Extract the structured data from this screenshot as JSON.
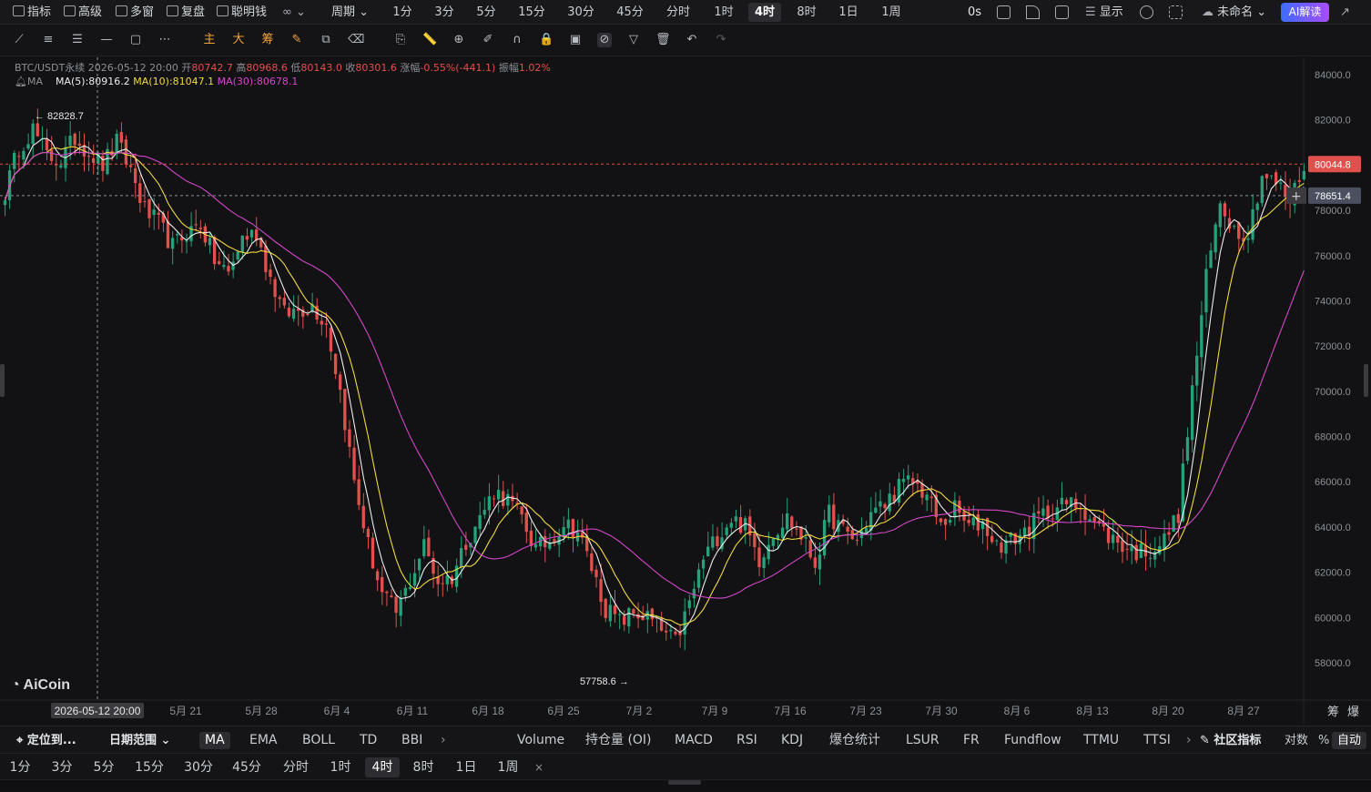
{
  "topbar": {
    "left_items": [
      {
        "label": "指标",
        "icon": "indicator-icon"
      },
      {
        "label": "高级",
        "icon": "advanced-icon"
      },
      {
        "label": "多窗",
        "icon": "multi-window-icon"
      },
      {
        "label": "复盘",
        "icon": "replay-icon"
      },
      {
        "label": "聪明钱",
        "icon": "smart-money-icon"
      }
    ],
    "period_menu": "周期",
    "periods": [
      "1分",
      "3分",
      "5分",
      "15分",
      "30分",
      "45分",
      "分时",
      "1时",
      "4时",
      "8时",
      "1日",
      "1周"
    ],
    "active_period": "4时",
    "countdown": "0s",
    "display_label": "显示",
    "layout_name": "未命名",
    "ai_button": "AI解读"
  },
  "chart_info": {
    "symbol": "BTC/USDT永续",
    "datetime": "2026-05-12 20:00",
    "open_label": "开",
    "open": "80742.7",
    "high_label": "高",
    "high": "80968.6",
    "low_label": "低",
    "low": "80143.0",
    "close_label": "收",
    "close": "80301.6",
    "change_label": "涨幅",
    "change": "-0.55%(-441.1)",
    "amplitude_label": "振幅",
    "amplitude": "1.02%",
    "ma_label": "MA",
    "ma5": "MA(5):80916.2",
    "ma10": "MA(10):81047.1",
    "ma30": "MA(30):80678.1"
  },
  "chart_data": {
    "type": "line",
    "title": "",
    "xlabel": "",
    "ylabel": "",
    "ylim": [
      56500,
      84500
    ],
    "x_ticks": [
      "2026-05-12 20:00",
      "5月 21",
      "5月 28",
      "6月 4",
      "6月 11",
      "6月 18",
      "6月 25",
      "7月 2",
      "7月 9",
      "7月 16",
      "7月 23",
      "7月 30",
      "8月 6",
      "8月 13",
      "8月 20",
      "8月 27"
    ],
    "y_ticks": [
      "84000.0",
      "82000.0",
      "80000.0",
      "78000.0",
      "76000.0",
      "74000.0",
      "72000.0",
      "70000.0",
      "68000.0",
      "66000.0",
      "64000.0",
      "62000.0",
      "60000.0",
      "58000.0"
    ],
    "y_tick_values": [
      84000,
      82000,
      80000,
      78000,
      76000,
      74000,
      72000,
      70000,
      68000,
      66000,
      64000,
      62000,
      60000,
      58000
    ],
    "price_series": [
      [
        0,
        78800
      ],
      [
        3,
        80800
      ],
      [
        6,
        81600
      ],
      [
        9,
        80400
      ],
      [
        12,
        80200
      ],
      [
        15,
        81200
      ],
      [
        18,
        80600
      ],
      [
        21,
        80000
      ],
      [
        24,
        81000
      ],
      [
        27,
        79800
      ],
      [
        30,
        78000
      ],
      [
        33,
        77400
      ],
      [
        36,
        76400
      ],
      [
        39,
        77000
      ],
      [
        42,
        77400
      ],
      [
        45,
        75800
      ],
      [
        48,
        75200
      ],
      [
        51,
        76800
      ],
      [
        54,
        77000
      ],
      [
        57,
        75000
      ],
      [
        60,
        73400
      ],
      [
        63,
        73600
      ],
      [
        66,
        73800
      ],
      [
        69,
        73000
      ],
      [
        72,
        70000
      ],
      [
        75,
        66000
      ],
      [
        78,
        63200
      ],
      [
        81,
        61000
      ],
      [
        84,
        60200
      ],
      [
        87,
        61600
      ],
      [
        90,
        63200
      ],
      [
        93,
        61600
      ],
      [
        96,
        61800
      ],
      [
        99,
        63400
      ],
      [
        102,
        64400
      ],
      [
        105,
        65600
      ],
      [
        108,
        65200
      ],
      [
        111,
        64400
      ],
      [
        114,
        63000
      ],
      [
        117,
        63400
      ],
      [
        120,
        64200
      ],
      [
        123,
        63800
      ],
      [
        126,
        62200
      ],
      [
        129,
        60400
      ],
      [
        132,
        59800
      ],
      [
        135,
        60200
      ],
      [
        138,
        60000
      ],
      [
        141,
        59400
      ],
      [
        144,
        58900
      ],
      [
        147,
        60600
      ],
      [
        150,
        62600
      ],
      [
        153,
        63600
      ],
      [
        156,
        64400
      ],
      [
        159,
        64000
      ],
      [
        162,
        62600
      ],
      [
        165,
        63800
      ],
      [
        168,
        64400
      ],
      [
        171,
        63600
      ],
      [
        174,
        62400
      ],
      [
        177,
        64600
      ],
      [
        180,
        63800
      ],
      [
        183,
        63400
      ],
      [
        186,
        64600
      ],
      [
        189,
        65000
      ],
      [
        192,
        65800
      ],
      [
        195,
        66000
      ],
      [
        198,
        65400
      ],
      [
        201,
        64000
      ],
      [
        204,
        64800
      ],
      [
        207,
        64000
      ],
      [
        210,
        64200
      ],
      [
        213,
        63200
      ],
      [
        216,
        63400
      ],
      [
        219,
        63800
      ],
      [
        222,
        64400
      ],
      [
        225,
        64800
      ],
      [
        228,
        65000
      ],
      [
        231,
        65000
      ],
      [
        234,
        64200
      ],
      [
        237,
        63600
      ],
      [
        240,
        63200
      ],
      [
        243,
        62900
      ],
      [
        246,
        63000
      ],
      [
        249,
        63400
      ],
      [
        252,
        64600
      ],
      [
        255,
        70000
      ],
      [
        258,
        75000
      ],
      [
        261,
        78400
      ],
      [
        264,
        77200
      ],
      [
        267,
        77000
      ],
      [
        270,
        79600
      ],
      [
        273,
        79200
      ],
      [
        276,
        78400
      ],
      [
        279,
        80000
      ]
    ],
    "current_price": "80044.8",
    "current_price_value": 80044.8,
    "cursor_price": "78651.4",
    "cursor_price_value": 78651.4,
    "high_marker": "82828.7",
    "high_marker_value": 82828.7,
    "low_marker": "57758.6",
    "low_marker_value": 57758.6,
    "colors": {
      "up": "#26a17a",
      "down": "#e0514d",
      "ma5": "#ededed",
      "ma10": "#f1da3b",
      "ma30": "#d347c8"
    },
    "grid": true
  },
  "indicator_bar": {
    "locate_label": "定位到...",
    "date_range_label": "日期范围",
    "main_indicators": [
      "MA",
      "EMA",
      "BOLL",
      "TD",
      "BBI"
    ],
    "active_main": "MA",
    "sub_indicators": [
      "Volume",
      "持仓量 (OI)",
      "MACD",
      "RSI",
      "KDJ",
      "爆仓统计",
      "LSUR",
      "FR",
      "Fundflow",
      "TTMU",
      "TTSI"
    ],
    "community_label": "社区指标",
    "log_label": "对数",
    "percent_label": "%",
    "auto_label": "自动"
  },
  "period_bar": {
    "periods": [
      "1分",
      "3分",
      "5分",
      "15分",
      "30分",
      "45分",
      "分时",
      "1时",
      "4时",
      "8时",
      "1日",
      "1周"
    ],
    "active": "4时",
    "close_symbol": "×"
  },
  "side_labels": {
    "chip": "筹",
    "liquidation": "爆"
  },
  "watermark": "AiCoin"
}
